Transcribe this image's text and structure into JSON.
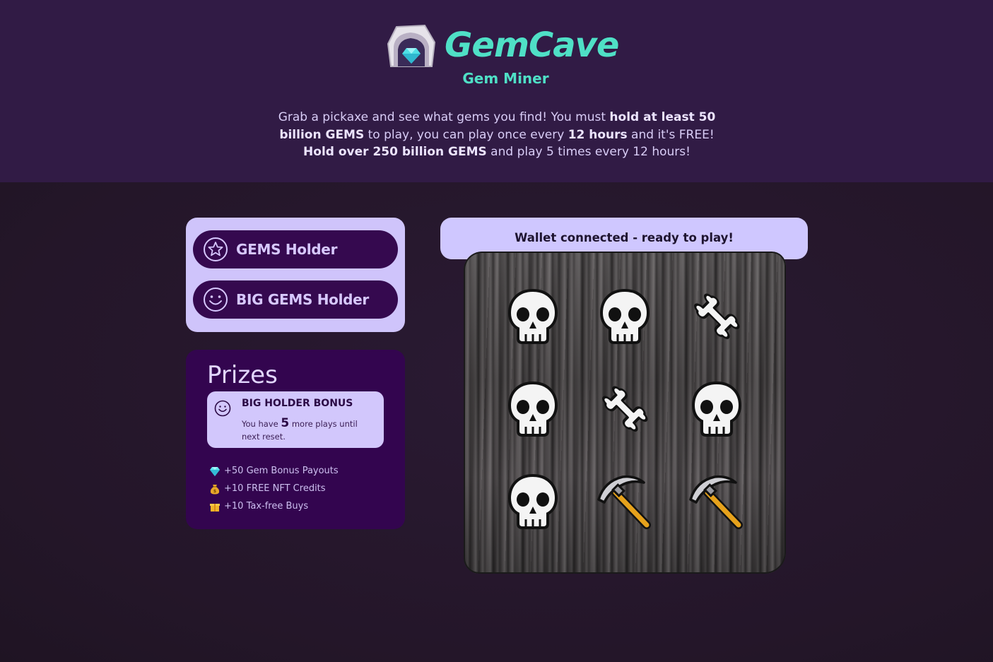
{
  "brand": {
    "name": "GemCave",
    "subtitle": "Gem Miner",
    "accent_color": "#4fe0c6",
    "logo_icon": "gem-cave-logo-icon"
  },
  "intro": {
    "p1": "Grab a pickaxe and see what gems you find! You must ",
    "b1": "hold at least 50 billion GEMS",
    "p2": " to play, you can play once every ",
    "b2": "12 hours",
    "p3": " and it's FREE! ",
    "b3": "Hold over 250 billion GEMS",
    "p4": " and play 5 times every 12 hours!"
  },
  "holders": {
    "gems_holder": {
      "label": "GEMS Holder",
      "icon": "star-circle-icon"
    },
    "big_gems_holder": {
      "label": "BIG GEMS Holder",
      "icon": "smiley-icon"
    }
  },
  "prizes": {
    "title": "Prizes",
    "bonus": {
      "title": "BIG HOLDER BONUS",
      "text_before": "You have ",
      "plays": "5",
      "text_after": " more plays until next reset."
    },
    "items": [
      {
        "icon": "diamond-icon",
        "label": "+50 Gem Bonus Payouts"
      },
      {
        "icon": "money-bag-icon",
        "label": "+10 FREE NFT Credits"
      },
      {
        "icon": "gift-icon",
        "label": "+10 Tax-free Buys"
      }
    ]
  },
  "status": {
    "text": "Wallet connected - ready to play!"
  },
  "board": {
    "cells": [
      "skull",
      "skull",
      "bone",
      "skull",
      "bone",
      "skull",
      "skull",
      "pickaxe",
      "pickaxe"
    ]
  },
  "colors": {
    "header_bg": "#311b45",
    "page_bg": "#26182f",
    "panel_light": "#cfc4fb",
    "button_dark": "#35094f",
    "prizes_bg": "#33054f"
  }
}
